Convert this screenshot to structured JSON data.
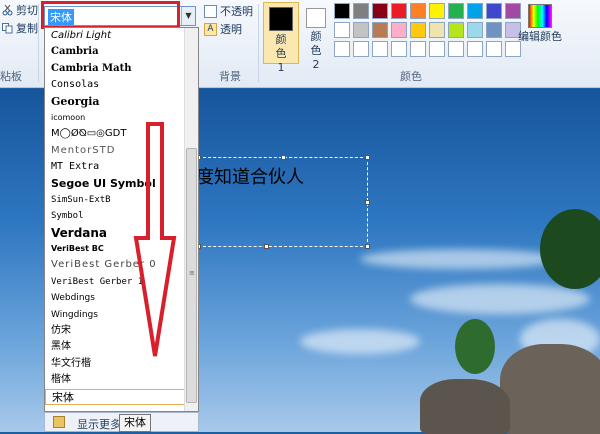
{
  "clipboard": {
    "cut": "剪切",
    "copy": "复制",
    "group_label": "粘板"
  },
  "font_combo": {
    "value": "宋体"
  },
  "background": {
    "opaque": "不透明",
    "transparent": "透明",
    "group_label": "背景"
  },
  "colors": {
    "color1_label": "颜色 1",
    "color2_label": "颜色 2",
    "group_label": "颜色",
    "edit_colors": "编辑颜色",
    "palette": [
      "#000000",
      "#7f7f7f",
      "#880015",
      "#ed1c24",
      "#ff7f27",
      "#fff200",
      "#22b14c",
      "#00a2e8",
      "#3f48cc",
      "#a349a4",
      "#ffffff",
      "#c3c3c3",
      "#b97a57",
      "#ffaec9",
      "#ffc90e",
      "#efe4b0",
      "#b5e61d",
      "#99d9ea",
      "#7092be",
      "#c8bfe7",
      "#ffffff",
      "#ffffff",
      "#ffffff",
      "#ffffff",
      "#ffffff",
      "#ffffff",
      "#ffffff",
      "#ffffff",
      "#ffffff",
      "#ffffff"
    ]
  },
  "canvas": {
    "text": "度知道合伙人"
  },
  "font_list": [
    "Calibri Light",
    "Cambria",
    "Cambria Math",
    "Consolas",
    "Georgia",
    "icomoon",
    "M◯Ø⦰▭◎GDT",
    "MentorSTD",
    "MT Extra",
    "Segoe UI Symbol",
    "SimSun-ExtB",
    "Symbol",
    "Verdana",
    "VeriBest BC",
    "VeriBest Gerber 0",
    "VeriBest Gerber 1",
    "Webdings",
    "Wingdings",
    "仿宋",
    "黑体",
    "华文行楷",
    "楷体",
    "宋体"
  ],
  "more_fonts": "显示更多字",
  "tooltip": "宋体"
}
